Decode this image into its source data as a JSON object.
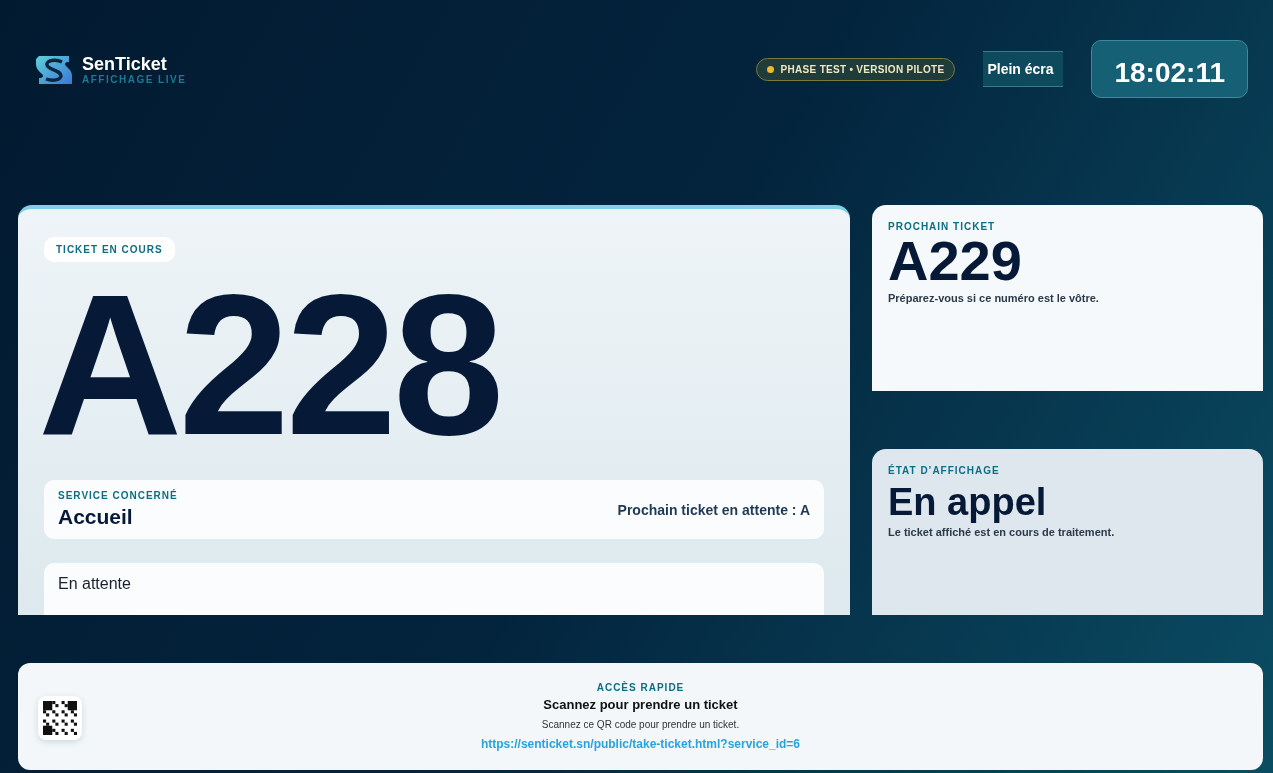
{
  "brand": {
    "name": "SenTicket",
    "subtitle": "AFFICHAGE LIVE"
  },
  "phase_badge": {
    "text": "PHASE TEST • VERSION PILOTE"
  },
  "fullscreen_button": {
    "label": "Plein écra"
  },
  "clock": {
    "time": "18:02:11"
  },
  "current_ticket": {
    "label": "TICKET EN COURS",
    "number": "A228",
    "service_label": "SERVICE CONCERNÉ",
    "service": "Accueil",
    "next_waiting": "Prochain ticket en attente : A",
    "status": "En attente"
  },
  "next_ticket": {
    "label": "PROCHAIN TICKET",
    "number": "A229",
    "hint": "Préparez-vous si ce numéro est le vôtre."
  },
  "display_state": {
    "label": "ÉTAT D’AFFICHAGE",
    "state": "En appel",
    "hint": "Le ticket affiché est en cours de traitement."
  },
  "quick_access": {
    "label": "ACCÈS RAPIDE",
    "title": "Scannez pour prendre un ticket",
    "hint": "Scannez ce QR code pour prendre un ticket.",
    "url": "https://senticket.sn/public/take-ticket.html?service_id=6"
  }
}
